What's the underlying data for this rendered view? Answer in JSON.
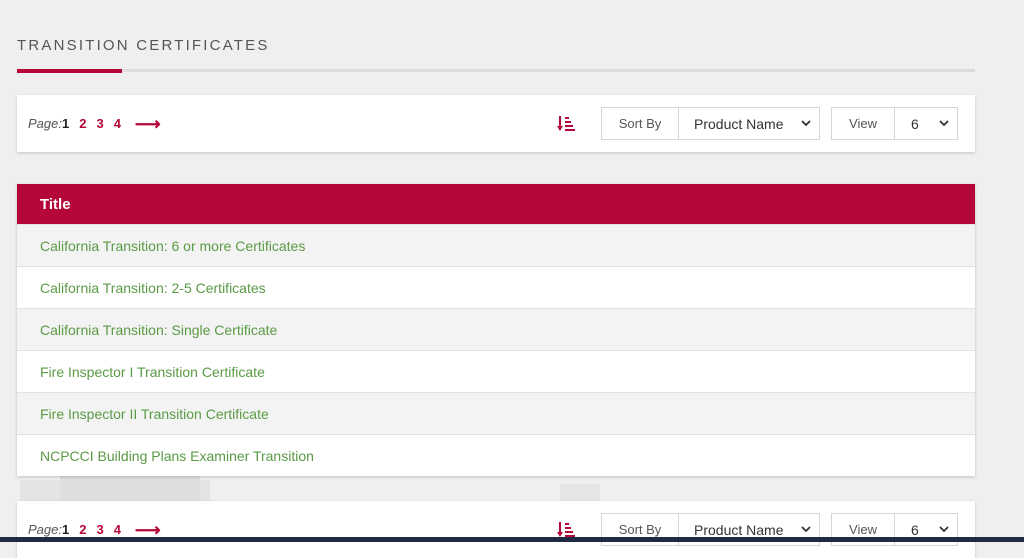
{
  "section": {
    "heading": "TRANSITION CERTIFICATES"
  },
  "pagination": {
    "label": "Page:",
    "current": "1",
    "pages": [
      "2",
      "3",
      "4"
    ],
    "next_icon": "arrow-right-icon"
  },
  "sort": {
    "icon": "sort-descending-icon",
    "label": "Sort By",
    "selected": "Product Name"
  },
  "view": {
    "label": "View",
    "selected": "6"
  },
  "table": {
    "header": "Title",
    "rows": [
      "California Transition: 6 or more Certificates",
      "California Transition: 2-5 Certificates",
      "California Transition: Single Certificate",
      "Fire Inspector I Transition Certificate",
      "Fire Inspector II Transition Certificate",
      "NCPCCI Building Plans Examiner Transition"
    ]
  },
  "colors": {
    "accent": "#b5073a",
    "link": "#5b9a45",
    "background": "#efefef"
  }
}
